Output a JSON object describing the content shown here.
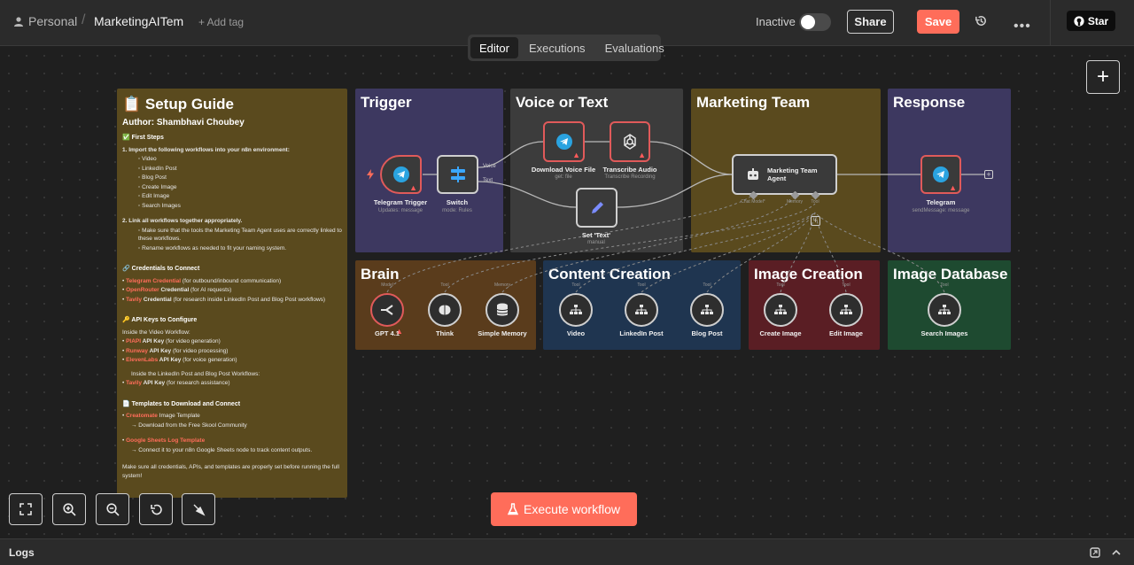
{
  "header": {
    "breadcrumb_project": "Personal",
    "workflow_name": "MarketingAITem",
    "add_tag": "+ Add tag",
    "status_label": "Inactive",
    "share_label": "Share",
    "save_label": "Save",
    "github_label": "Star"
  },
  "tabs": [
    {
      "label": "Editor",
      "active": true
    },
    {
      "label": "Executions",
      "active": false
    },
    {
      "label": "Evaluations",
      "active": false
    }
  ],
  "stickies": {
    "trigger": "Trigger",
    "voice": "Voice or Text",
    "marketing": "Marketing Team",
    "response": "Response",
    "brain": "Brain",
    "content": "Content Creation",
    "image": "Image Creation",
    "imagedb": "Image Database"
  },
  "guide": {
    "title": "📋 Setup Guide",
    "author": "Author: Shambhavi Choubey",
    "first_steps": "✅ First Steps",
    "step1": "1. Import the following workflows into your n8n environment:",
    "workflows": [
      "Video",
      "LinkedIn Post",
      "Blog Post",
      "Create Image",
      "Edit Image",
      "Search Images"
    ],
    "step2": "2. Link all workflows together appropriately.",
    "step2_items": [
      "Make sure that the tools the Marketing Team Agent uses are correctly linked to these workflows.",
      "Rename workflows as needed to fit your naming system."
    ],
    "cred_head": "🔗 Credentials to Connect",
    "creds": [
      {
        "name": "Telegram Credential",
        "desc": " (for outbound/inbound communication)"
      },
      {
        "name": "OpenRouter",
        "bold": " Credential",
        "desc": " (for AI requests)"
      },
      {
        "name": "Tavily",
        "bold": " Credential",
        "desc": " (for research inside LinkedIn Post and Blog Post workflows)"
      }
    ],
    "api_head": "🔑 API Keys to Configure",
    "api_inside_video": "Inside the Video Workflow:",
    "api_video": [
      {
        "name": "PIAPI",
        "bold": " API Key",
        "desc": " (for video generation)"
      },
      {
        "name": "Runway",
        "bold": " API Key",
        "desc": " (for video processing)"
      },
      {
        "name": "ElevenLabs",
        "bold": " API Key",
        "desc": " (for voice generation)"
      }
    ],
    "api_inside_posts": "Inside the LinkedIn Post and Blog Post Workflows:",
    "api_posts": [
      {
        "name": "Tavily",
        "bold": " API Key",
        "desc": " (for research assistance)"
      }
    ],
    "tmpl_head": "📄 Templates to Download and Connect",
    "tmpl1_name": "Creatomate",
    "tmpl1_rest": " Image Template",
    "tmpl1_note": "→ Download from the Free Skool Community",
    "tmpl2_name": "Google Sheets Log Template",
    "tmpl2_note": "→ Connect it to your n8n Google Sheets node to track content outputs.",
    "footer": "Make sure all credentials, APIs, and templates are properly set before running the full system!"
  },
  "nodes": {
    "telegram_trigger": {
      "label": "Telegram Trigger",
      "sub": "Updates: message"
    },
    "switch": {
      "label": "Switch",
      "sub": "mode: Rules",
      "out_voice": "Voice",
      "out_text": "Text"
    },
    "download_voice": {
      "label": "Download Voice File",
      "sub": "get: file"
    },
    "transcribe": {
      "label": "Transcribe Audio",
      "sub": "Transcribe Recording"
    },
    "set_text": {
      "label": "Set 'Text'",
      "sub": "manual"
    },
    "agent": {
      "label": "Marketing Team Agent",
      "port_chat": "Chat Model*",
      "port_memory": "Memory",
      "port_tool": "Tool"
    },
    "telegram": {
      "label": "Telegram",
      "sub": "sendMessage: message"
    },
    "gpt": {
      "label": "GPT 4.1",
      "port": "Model"
    },
    "think": {
      "label": "Think",
      "port": "Tool"
    },
    "memory": {
      "label": "Simple Memory",
      "port": "Memory"
    },
    "video": {
      "label": "Video",
      "port": "Tool"
    },
    "linkedin": {
      "label": "LinkedIn Post",
      "port": "Tool"
    },
    "blog": {
      "label": "Blog Post",
      "port": "Tool"
    },
    "create_image": {
      "label": "Create Image",
      "port": "Tool"
    },
    "edit_image": {
      "label": "Edit Image",
      "port": "Tool"
    },
    "search_images": {
      "label": "Search Images",
      "port": "Tool"
    }
  },
  "execute_label": "Execute workflow",
  "logs_label": "Logs",
  "colors": {
    "accent": "#ff6d5a",
    "sticky_yellow": "#5a4a1e",
    "sticky_purple": "#3d3860",
    "sticky_blue": "#1f3550",
    "sticky_red": "#5a1e24",
    "sticky_green": "#1e4a30"
  }
}
